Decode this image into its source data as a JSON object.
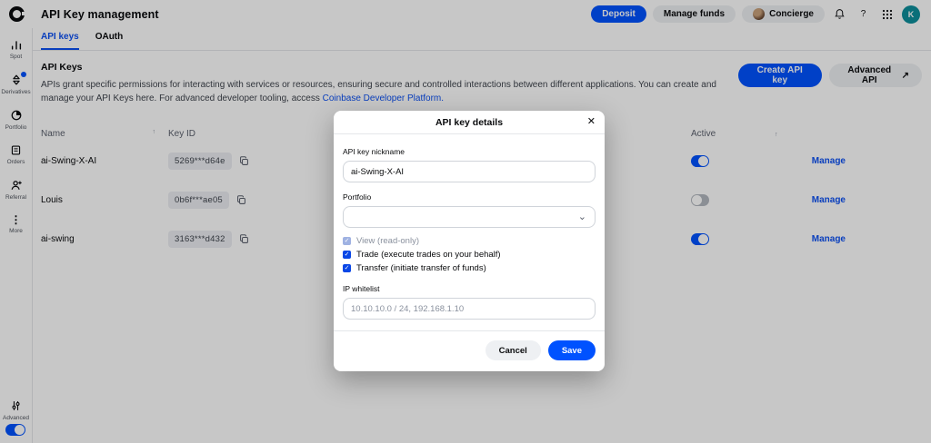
{
  "header": {
    "title": "API Key management",
    "deposit_label": "Deposit",
    "manage_funds_label": "Manage funds",
    "concierge_label": "Concierge",
    "avatar_initial": "K"
  },
  "sidebar": {
    "items": [
      {
        "label": "Spot"
      },
      {
        "label": "Derivatives",
        "badge": true
      },
      {
        "label": "Portfolio"
      },
      {
        "label": "Orders"
      },
      {
        "label": "Referral"
      },
      {
        "label": "More"
      }
    ],
    "advanced_label": "Advanced",
    "advanced_toggle_on": true
  },
  "tabs": [
    {
      "label": "API keys",
      "active": true
    },
    {
      "label": "OAuth",
      "active": false
    }
  ],
  "section": {
    "title": "API Keys",
    "description": "APIs grant specific permissions for interacting with services or resources, ensuring secure and controlled interactions between different applications. You can create and manage your API Keys here. For advanced developer tooling, access ",
    "link_text": "Coinbase Developer Platform.",
    "create_button": "Create API key",
    "advanced_button": "Advanced API"
  },
  "table": {
    "columns": {
      "name": "Name",
      "key_id": "Key ID",
      "active": "Active"
    },
    "manage_label": "Manage",
    "rows": [
      {
        "name": "ai-Swing-X-AI",
        "key_id": "5269***d64e",
        "active": true,
        "manage": "Manage"
      },
      {
        "name": "Louis",
        "key_id": "0b6f***ae05",
        "active": false,
        "manage": "Manage"
      },
      {
        "name": "ai-swing",
        "key_id": "3163***d432",
        "active": true,
        "manage": "Manage"
      }
    ]
  },
  "modal": {
    "title": "API key details",
    "nickname_label": "API key nickname",
    "nickname_value": "ai-Swing-X-AI",
    "portfolio_label": "Portfolio",
    "portfolio_value": "",
    "permissions": [
      {
        "label": "View (read-only)",
        "checked": true,
        "disabled": true
      },
      {
        "label": "Trade (execute trades on your behalf)",
        "checked": true,
        "disabled": false
      },
      {
        "label": "Transfer (initiate transfer of funds)",
        "checked": true,
        "disabled": false
      }
    ],
    "ip_label": "IP whitelist",
    "ip_placeholder": "10.10.10.0 / 24, 192.168.1.10",
    "cancel_label": "Cancel",
    "save_label": "Save"
  },
  "icons": {
    "sort": "↑",
    "external": "↗",
    "close": "✕",
    "chevron_down": "⌄",
    "help": "?",
    "check": "✓",
    "more_dots": "⋮"
  },
  "colors": {
    "accent": "#0052ff",
    "link": "#0c50f2",
    "toggle_off": "#b3b8bf",
    "avatar_teal": "#0e8f9b"
  }
}
